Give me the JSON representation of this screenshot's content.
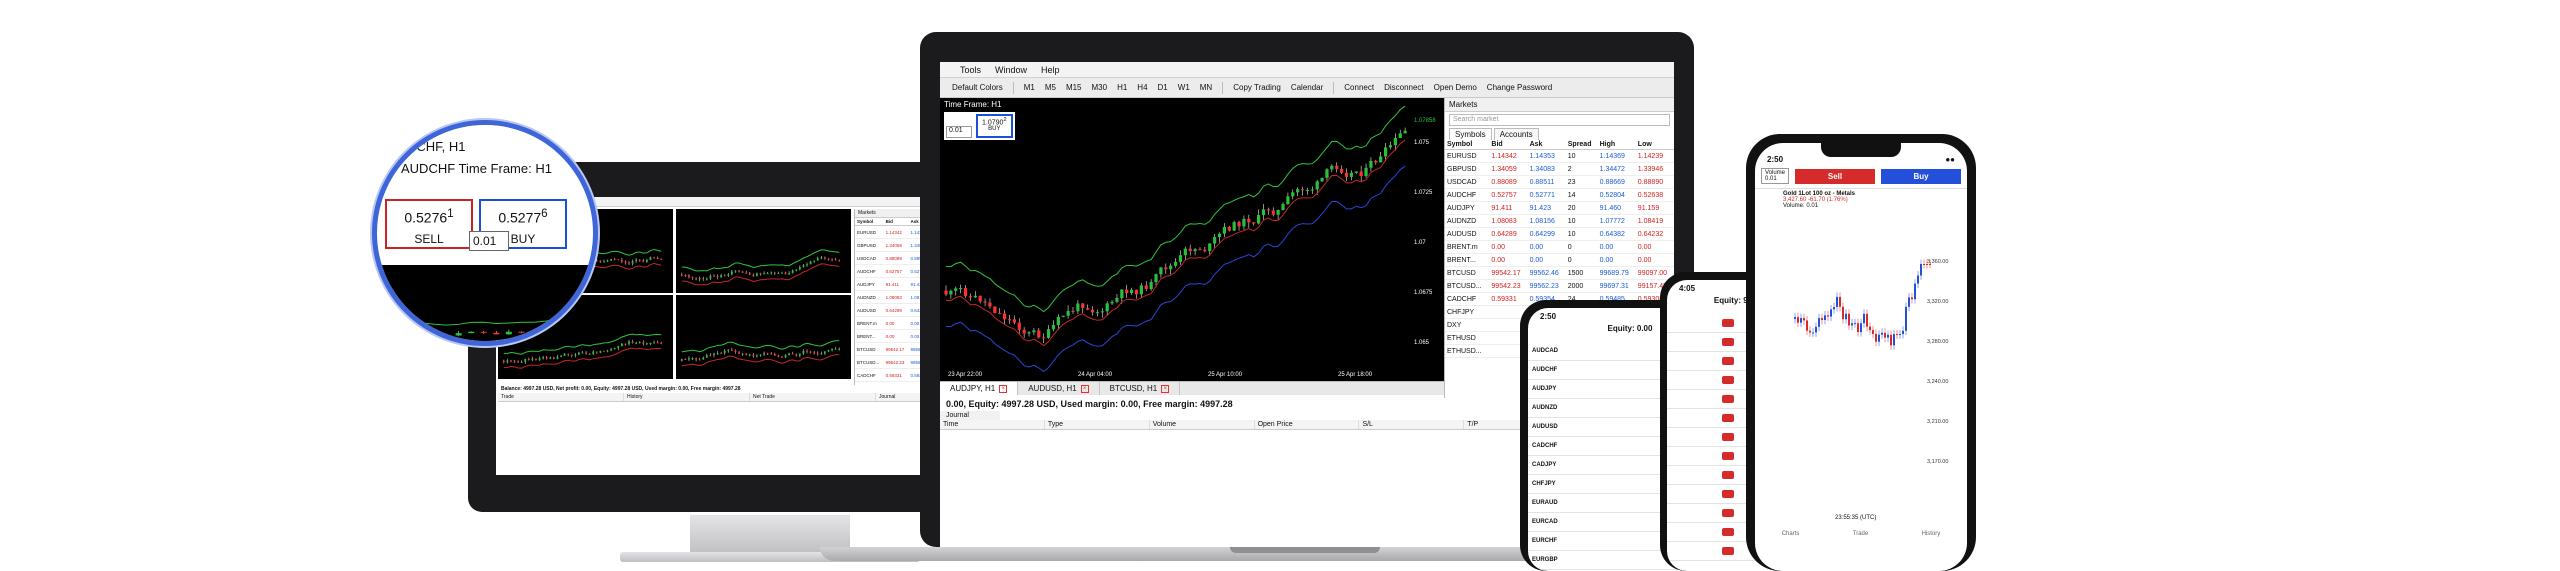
{
  "monitor": {
    "timeframe_label": "AUDCHF Time Frame: H1",
    "trade": {
      "sell_price": "0.5276",
      "sell_sup": "1",
      "buy_price": "0.5277",
      "buy_sup": "6",
      "lot": "0.01"
    },
    "status_line": "Balance: 4997.28 USD, Net profit: 0.00, Equity: 4997.28 USD, Used margin: 0.00, Free margin: 4997.28",
    "bottom_tabs": [
      "Trade",
      "History",
      "Net Trade",
      "Journal"
    ],
    "chart_tabs": [
      "AUDJPY, H1",
      "AUDUSD, H1",
      "BTCUSD, H1"
    ]
  },
  "laptop": {
    "menu": [
      "Tools",
      "Window",
      "Help"
    ],
    "toolbar": [
      "Default Colors",
      "M1",
      "M5",
      "M15",
      "M30",
      "H1",
      "H4",
      "D1",
      "W1",
      "MN",
      "Copy Trading",
      "Calendar",
      "Connect",
      "Disconnect",
      "Open Demo",
      "Change Password"
    ],
    "chart_title": "Time Frame: H1",
    "chart_trade": {
      "buy_price": "1.0790",
      "buy_sup": "2",
      "lot": "0.01",
      "buy_label": "BUY"
    },
    "price_axis": [
      "1.075",
      "1.0725",
      "1.07",
      "1.0675",
      "1.065"
    ],
    "current_price": "1.07858",
    "time_axis": [
      "23 Apr 22:00",
      "24 Apr 04:00",
      "25 Apr 10:00",
      "25 Apr 18:00"
    ],
    "chart_tabs": [
      "AUDJPY, H1",
      "AUDUSD, H1",
      "BTCUSD, H1"
    ],
    "status_line": "0.00, Equity: 4997.28 USD, Used margin: 0.00, Free margin: 4997.28",
    "journal_label": "Journal",
    "grid_headers": [
      "Time",
      "Type",
      "Volume",
      "Open Price",
      "S/L",
      "T/P",
      "current price"
    ],
    "markets": {
      "title": "Markets",
      "search_placeholder": "Search market",
      "tabs": [
        "Symbols",
        "Accounts"
      ],
      "headers": [
        "Symbol",
        "Bid",
        "Ask",
        "Spread",
        "High",
        "Low"
      ],
      "rows": [
        [
          "EURUSD",
          "1.14342",
          "1.14353",
          "10",
          "1.14369",
          "1.14239"
        ],
        [
          "GBPUSD",
          "1.34059",
          "1.34083",
          "2",
          "1.34472",
          "1.33946"
        ],
        [
          "USDCAD",
          "0.88089",
          "0.88511",
          "23",
          "0.88669",
          "0.88890"
        ],
        [
          "AUDCHF",
          "0.52757",
          "0.52771",
          "14",
          "0.52804",
          "0.52638"
        ],
        [
          "AUDJPY",
          "91.411",
          "91.423",
          "20",
          "91.460",
          "91.159"
        ],
        [
          "AUDNZD",
          "1.08083",
          "1.08156",
          "10",
          "1.07772",
          "1.08419"
        ],
        [
          "AUDUSD",
          "0.64289",
          "0.64299",
          "10",
          "0.64382",
          "0.64232"
        ],
        [
          "BRENT.m",
          "0.00",
          "0.00",
          "0",
          "0.00",
          "0.00"
        ],
        [
          "BRENT...",
          "0.00",
          "0.00",
          "0",
          "0.00",
          "0.00"
        ],
        [
          "BTCUSD",
          "99542.17",
          "99562.46",
          "1500",
          "99689.79",
          "99097.00"
        ],
        [
          "BTCUSD...",
          "99542.23",
          "99562.23",
          "2000",
          "99697.31",
          "99157.48"
        ],
        [
          "CADCHF",
          "0.59331",
          "0.59354",
          "24",
          "0.59485",
          "0.59308"
        ],
        [
          "CHFJPY",
          "",
          "",
          "",
          "",
          ""
        ],
        [
          "DXY",
          "",
          "",
          "",
          "",
          ""
        ],
        [
          "ETHUSD",
          "",
          "",
          "",
          "",
          ""
        ],
        [
          "ETHUSD...",
          "",
          "",
          "",
          "",
          ""
        ]
      ]
    }
  },
  "phone_small": {
    "time": "2:50",
    "title": "Equity: 0.00",
    "column_label": "One Click",
    "symbols": [
      "AUDCAD",
      "AUDCHF",
      "AUDJPY",
      "AUDNZD",
      "AUDUSD",
      "CADCHF",
      "CADJPY",
      "CHFJPY",
      "EURAUD",
      "EURCAD",
      "EURCHF",
      "EURGBP"
    ]
  },
  "phone_mid": {
    "time": "4:05",
    "title": "Equity: 9999.02",
    "column_label": "One Click",
    "rows": 13
  },
  "phone_big": {
    "time": "2:50",
    "volume_label": "Volume",
    "volume_value": "0.01",
    "sell_label": "Sell",
    "buy_label": "Buy",
    "instrument": "Gold 1Lot 100 oz - Metals",
    "change": "3,427.60 -61.70 (1.76%)",
    "volume_sub": "Volume: 0.01",
    "price_axis": [
      "3,360.00",
      "3,320.00",
      "3,280.00",
      "3,240.00",
      "3,210.00",
      "3,170.00"
    ],
    "time_label": "23:55:35 (UTC)",
    "nav": [
      "Charts",
      "Trade",
      "History"
    ]
  }
}
